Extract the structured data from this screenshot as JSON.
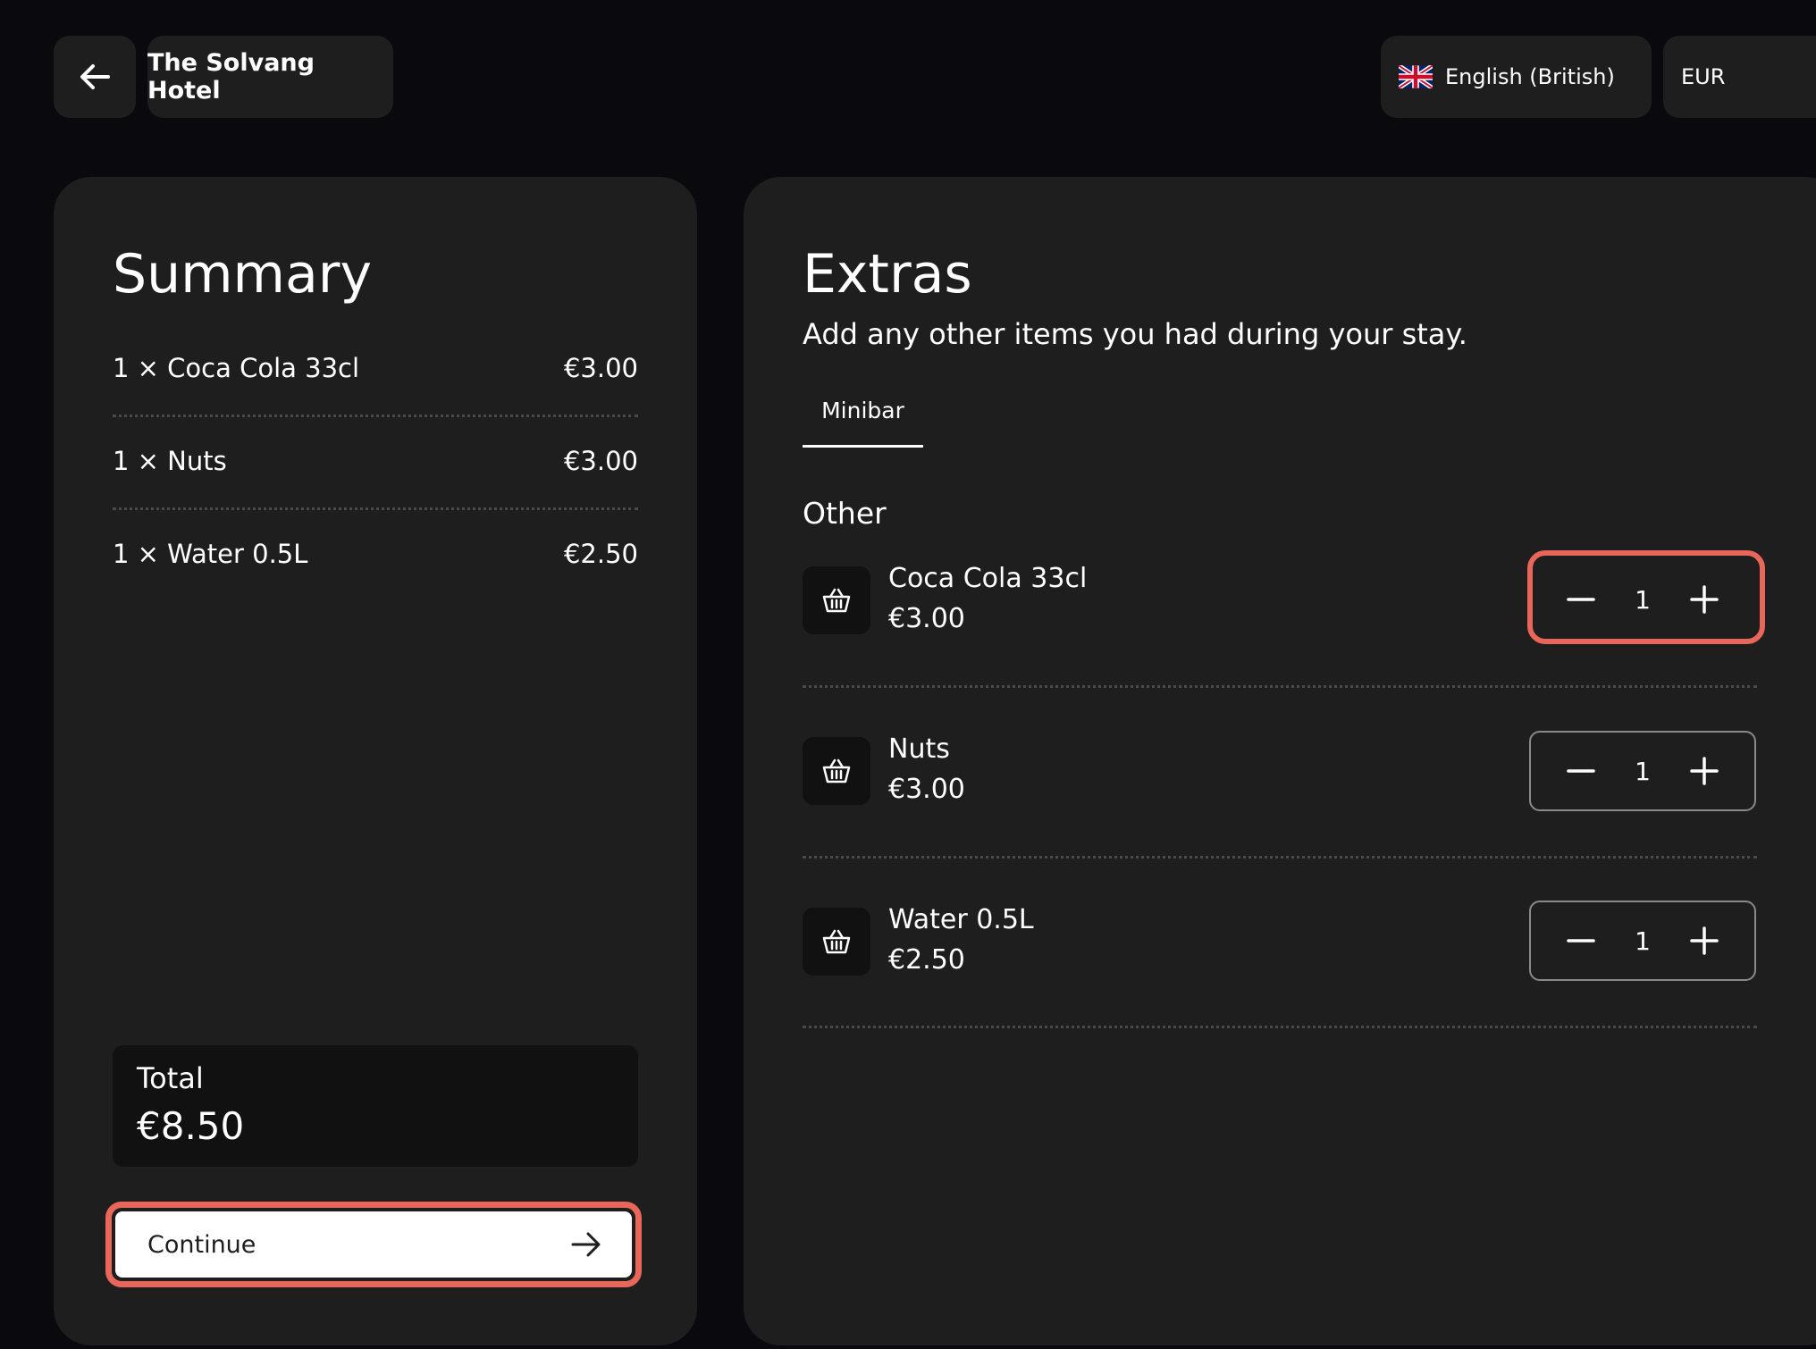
{
  "header": {
    "hotel_name": "The Solvang Hotel",
    "language": "English (British)",
    "currency": "EUR"
  },
  "summary": {
    "title": "Summary",
    "lines": [
      {
        "label": "1 × Coca Cola 33cl",
        "price": "€3.00"
      },
      {
        "label": "1 × Nuts",
        "price": "€3.00"
      },
      {
        "label": "1 × Water 0.5L",
        "price": "€2.50"
      }
    ],
    "total_label": "Total",
    "total_value": "€8.50",
    "continue_label": "Continue"
  },
  "extras": {
    "title": "Extras",
    "subtitle": "Add any other items you had during your stay.",
    "tabs": [
      {
        "label": "Minibar",
        "active": true
      }
    ],
    "section_title": "Other",
    "items": [
      {
        "name": "Coca Cola 33cl",
        "price": "€3.00",
        "quantity": "1",
        "icon": "basket-icon"
      },
      {
        "name": "Nuts",
        "price": "€3.00",
        "quantity": "1",
        "icon": "basket-icon"
      },
      {
        "name": "Water 0.5L",
        "price": "€2.50",
        "quantity": "1",
        "icon": "basket-icon"
      }
    ]
  },
  "colors": {
    "background": "#0a0a0e",
    "panel": "#1e1e1e",
    "highlight": "#e8675a"
  }
}
